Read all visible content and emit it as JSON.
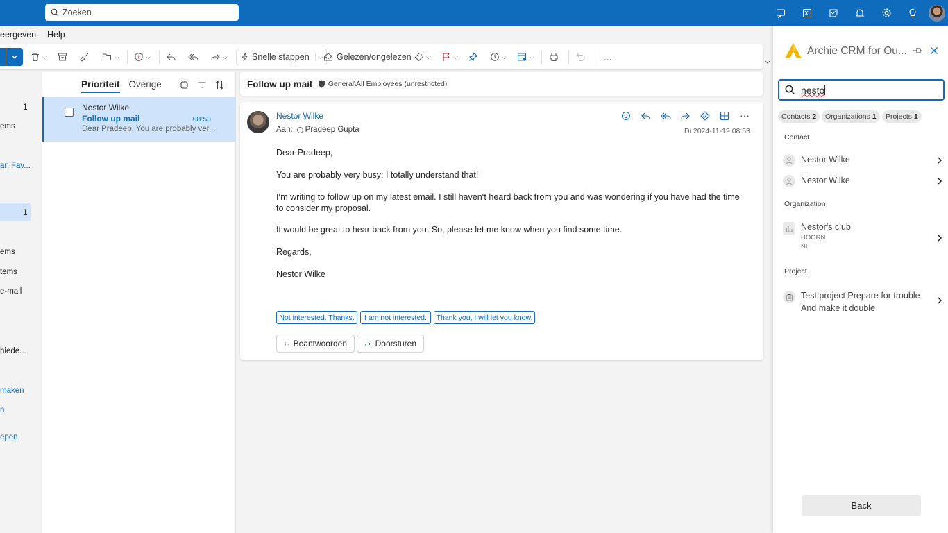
{
  "search": {
    "placeholder": "Zoeken"
  },
  "menu": {
    "partial_left": "eergeven",
    "help": "Help"
  },
  "toolbar": {
    "quick_steps": "Snelle stappen",
    "read_unread": "Gelezen/ongelezen",
    "more": "..."
  },
  "nav": {
    "items": [
      "1",
      "ems",
      "an Fav...",
      "1",
      "ems",
      "tems",
      "e-mail",
      "hiede...",
      "maken",
      "n",
      "epen"
    ]
  },
  "msglist": {
    "tab_priority": "Prioriteit",
    "tab_other": "Overige",
    "items": [
      {
        "sender": "Nestor Wilke",
        "subject": "Follow up mail",
        "time": "08:53",
        "preview": "Dear Pradeep, You are probably ver..."
      }
    ]
  },
  "reading": {
    "subject": "Follow up mail",
    "sensitivity": "General\\All Employees (unrestricted)",
    "sender": "Nestor Wilke",
    "to_label": "Aan:",
    "to": "Pradeep Gupta",
    "date": "Di 2024-11-19 08:53",
    "body": [
      "Dear Pradeep,",
      "You are probably very busy; I totally understand that!",
      "I‘m writing to follow up on my latest email. I still haven‘t heard back from you and was wondering if you have had the time to consider my proposal.",
      "It would be great to hear back from you. So, please let me know when you find some time.",
      "Regards,",
      "Nestor Wilke"
    ],
    "suggested_replies": [
      "Not interested. Thanks.",
      "I am not interested.",
      "Thank you, I will let you know."
    ],
    "reply_label": "Beantwoorden",
    "forward_label": "Doorsturen"
  },
  "panel": {
    "title": "Archie CRM for Ou...",
    "search_value": "nesto",
    "chips": [
      {
        "label": "Contacts",
        "count": "2"
      },
      {
        "label": "Organizations",
        "count": "1"
      },
      {
        "label": "Projects",
        "count": "1"
      }
    ],
    "contact_heading": "Contact",
    "contacts": [
      "Nestor Wilke",
      "Nestor Wilke"
    ],
    "org_heading": "Organization",
    "org": {
      "name": "Nestor's club",
      "city": "HOORN",
      "country": "NL"
    },
    "project_heading": "Project",
    "project": {
      "line1": "Test project Prepare for trouble",
      "line2": "And make it double"
    },
    "back_label": "Back"
  },
  "colors": {
    "accent": "#0f6cbd",
    "selected": "#cfe4fa",
    "logo": "#f4b400"
  }
}
